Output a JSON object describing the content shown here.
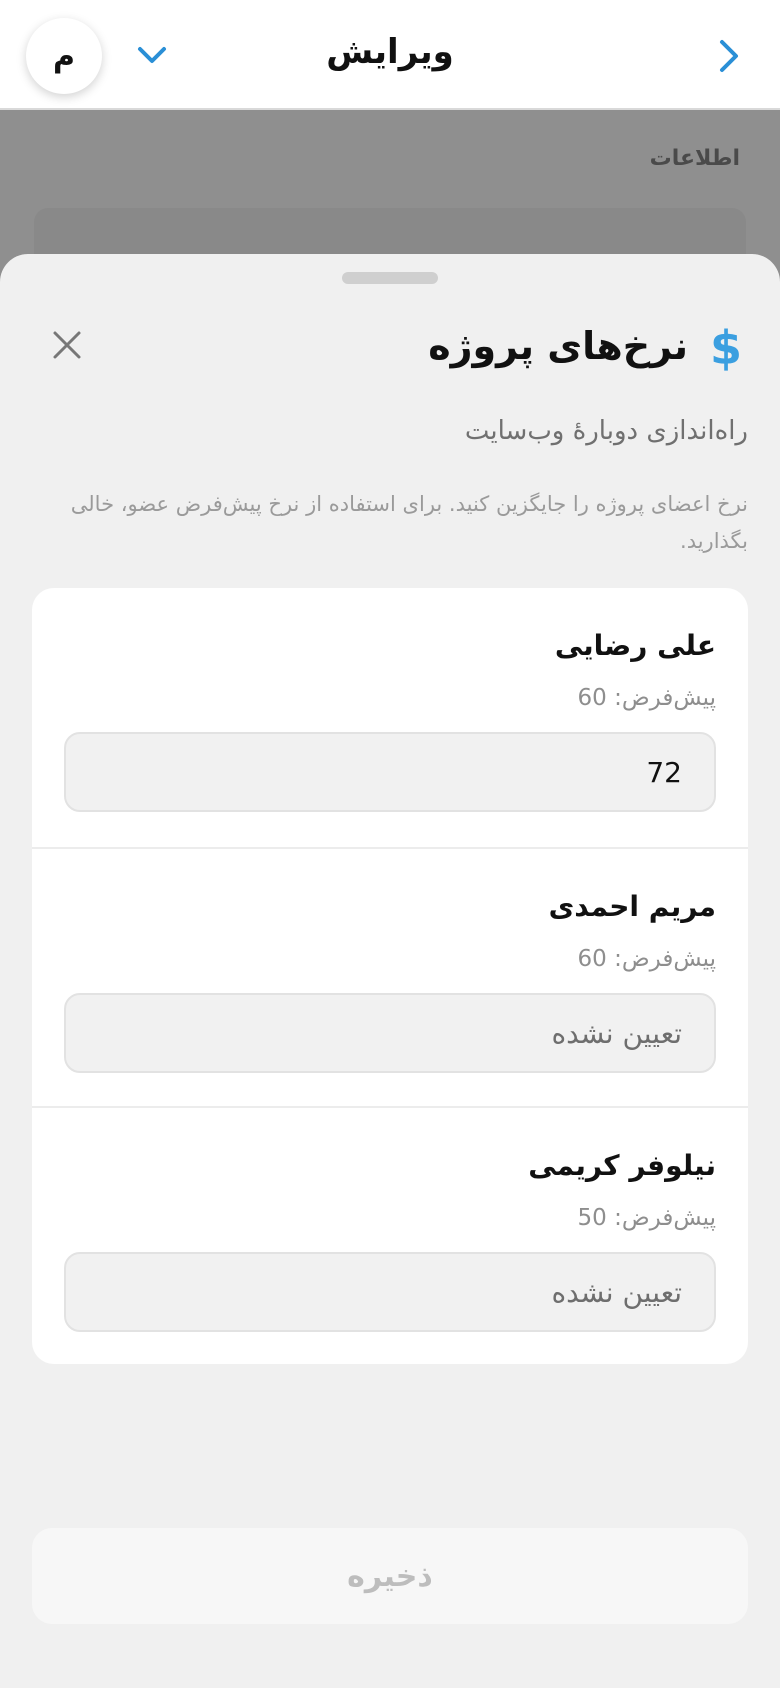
{
  "topbar": {
    "title": "ویرایش",
    "avatar_initial": "م",
    "back_icon": "chevron-right-icon",
    "menu_icon": "chevron-down-icon"
  },
  "background": {
    "section_label": "اطلاعات"
  },
  "sheet": {
    "title": "نرخ‌های پروژه",
    "title_icon": "dollar-icon",
    "dollar_glyph": "$",
    "project_name": "راه‌اندازی دوبارهٔ وب‌سایت",
    "hint": "نرخ اعضای پروژه را جایگزین کنید. برای استفاده از نرخ پیش‌فرض عضو، خالی بگذارید.",
    "members": [
      {
        "name": "علی رضایی",
        "default_label": "پیش‌فرض: 60",
        "value": "72",
        "placeholder": "تعیین نشده"
      },
      {
        "name": "مریم احمدی",
        "default_label": "پیش‌فرض: 60",
        "value": "",
        "placeholder": "تعیین نشده"
      },
      {
        "name": "نیلوفر کریمی",
        "default_label": "پیش‌فرض: 50",
        "value": "",
        "placeholder": "تعیین نشده"
      }
    ],
    "save_label": "ذخیره"
  },
  "colors": {
    "accent": "#3b9fe0",
    "overlay": "#8f8f8f",
    "sheet_bg": "#f0f0f0"
  }
}
